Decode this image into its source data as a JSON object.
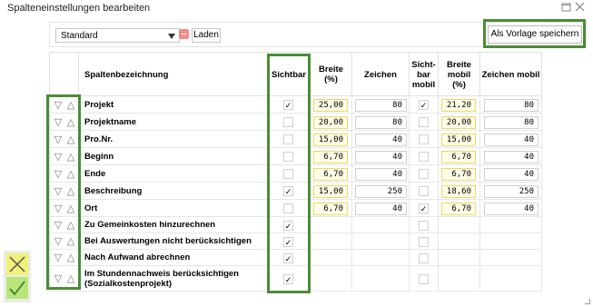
{
  "window": {
    "title": "Spalteneinstellungen bearbeiten",
    "maximize_icon": "maximize-icon",
    "close_icon": "close-icon"
  },
  "toolbar": {
    "preset_value": "Standard",
    "load_label": "Laden",
    "save_template_label": "Als Vorlage speichern",
    "remove_icon": "minus-icon"
  },
  "columns": {
    "name": "Spaltenbezeichnung",
    "visible": "Sichtbar",
    "width_pct": "Breite\n(%)",
    "chars": "Zeichen",
    "visible_mobile": "Sicht-\nbar\nmobil",
    "width_mobile_pct": "Breite\nmobil\n(%)",
    "chars_mobile": "Zeichen mobil"
  },
  "rows": [
    {
      "name": "Projekt",
      "visible": true,
      "width": "25,00",
      "chars": "80",
      "visible_mobile": true,
      "width_mobile": "21,20",
      "chars_mobile": "80"
    },
    {
      "name": "Projektname",
      "visible": false,
      "width": "20,00",
      "chars": "80",
      "visible_mobile": false,
      "width_mobile": "20,00",
      "chars_mobile": "80"
    },
    {
      "name": "Pro.Nr.",
      "visible": false,
      "width": "15,00",
      "chars": "40",
      "visible_mobile": false,
      "width_mobile": "15,00",
      "chars_mobile": "40"
    },
    {
      "name": "Beginn",
      "visible": false,
      "width": "6,70",
      "chars": "40",
      "visible_mobile": false,
      "width_mobile": "6,70",
      "chars_mobile": "40"
    },
    {
      "name": "Ende",
      "visible": false,
      "width": "6,70",
      "chars": "40",
      "visible_mobile": false,
      "width_mobile": "6,70",
      "chars_mobile": "40"
    },
    {
      "name": "Beschreibung",
      "visible": true,
      "width": "15,00",
      "chars": "250",
      "visible_mobile": false,
      "width_mobile": "18,60",
      "chars_mobile": "250"
    },
    {
      "name": "Ort",
      "visible": false,
      "width": "6,70",
      "chars": "40",
      "visible_mobile": true,
      "width_mobile": "6,70",
      "chars_mobile": "40"
    },
    {
      "name": "Zu Gemeinkosten hinzurechnen",
      "visible": true,
      "visible_mobile": false
    },
    {
      "name": "Bei Auswertungen nicht berücksichtigen",
      "visible": true,
      "visible_mobile": false
    },
    {
      "name": "Nach Aufwand abrechnen",
      "visible": true,
      "visible_mobile": false
    },
    {
      "name": "Im Stundennachweis berücksichtigen\n(Sozialkostenprojekt)",
      "visible": true,
      "visible_mobile": false
    }
  ],
  "glyphs": {
    "check": "✓",
    "down": "▽",
    "up": "△"
  },
  "actions": {
    "cancel_icon": "cancel-x-icon",
    "confirm_icon": "confirm-check-icon"
  },
  "colors": {
    "highlight_green": "#4c8c36",
    "input_yellow_border": "#e6d96a",
    "cancel_bg": "#f2f07a",
    "confirm_bg": "#b6e57a",
    "remove_red": "#f28c8c"
  }
}
